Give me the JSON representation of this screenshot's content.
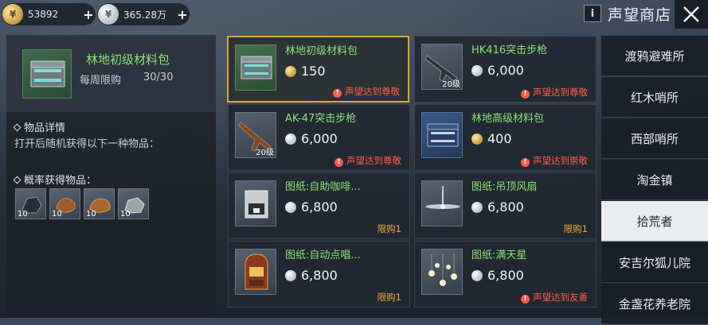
{
  "currency": {
    "gold_value": "53892",
    "silver_value": "365.28万",
    "gold_icon": "gold-coin-icon",
    "silver_icon": "silver-coin-icon"
  },
  "header": {
    "info_label": "i",
    "title": "声望商店"
  },
  "detail": {
    "name": "林地初级材料包",
    "limit": "每周限购",
    "limit_count": "30/30",
    "section1_title": "物品详情",
    "section1_text": "打开后随机获得以下一种物品：",
    "section2_title": "概率获得物品：",
    "drops": [
      {
        "qty": "10"
      },
      {
        "qty": "10"
      },
      {
        "qty": "10"
      },
      {
        "qty": "10"
      }
    ]
  },
  "items": [
    {
      "name": "林地初级材料包",
      "price": "150",
      "currency": "gold",
      "note": "声望达到尊敬",
      "note_type": "red"
    },
    {
      "name": "HK416突击步枪",
      "price": "6,000",
      "currency": "silver",
      "note": "声望达到尊敬",
      "note_type": "red",
      "level": "20级"
    },
    {
      "name": "AK-47突击步枪",
      "price": "6,000",
      "currency": "silver",
      "note": "声望达到尊敬",
      "note_type": "red",
      "level": "20级"
    },
    {
      "name": "林地高级材料包",
      "price": "400",
      "currency": "gold",
      "note": "声望达到崇敬",
      "note_type": "red"
    },
    {
      "name": "图纸:自助咖啡...",
      "price": "6,800",
      "currency": "silver",
      "note": "限购1",
      "note_type": "orange"
    },
    {
      "name": "图纸:吊顶风扇",
      "price": "6,800",
      "currency": "silver",
      "note": "限购1",
      "note_type": "orange"
    },
    {
      "name": "图纸:自动点唱...",
      "price": "6,800",
      "currency": "silver",
      "note": "限购1",
      "note_type": "orange"
    },
    {
      "name": "图纸:满天星",
      "price": "6,800",
      "currency": "silver",
      "note": "声望达到友善",
      "note_type": "red"
    }
  ],
  "tabs": [
    {
      "label": "渡鸦避难所"
    },
    {
      "label": "红木哨所"
    },
    {
      "label": "西部哨所"
    },
    {
      "label": "淘金镇"
    },
    {
      "label": "拾荒者"
    },
    {
      "label": "安吉尔狐儿院"
    },
    {
      "label": "金盏花养老院"
    }
  ],
  "colors": {
    "accent_gold": "#d8a43d",
    "name_green": "#8fe07a",
    "note_red": "#ff5a4a",
    "note_orange": "#f0a83a"
  }
}
